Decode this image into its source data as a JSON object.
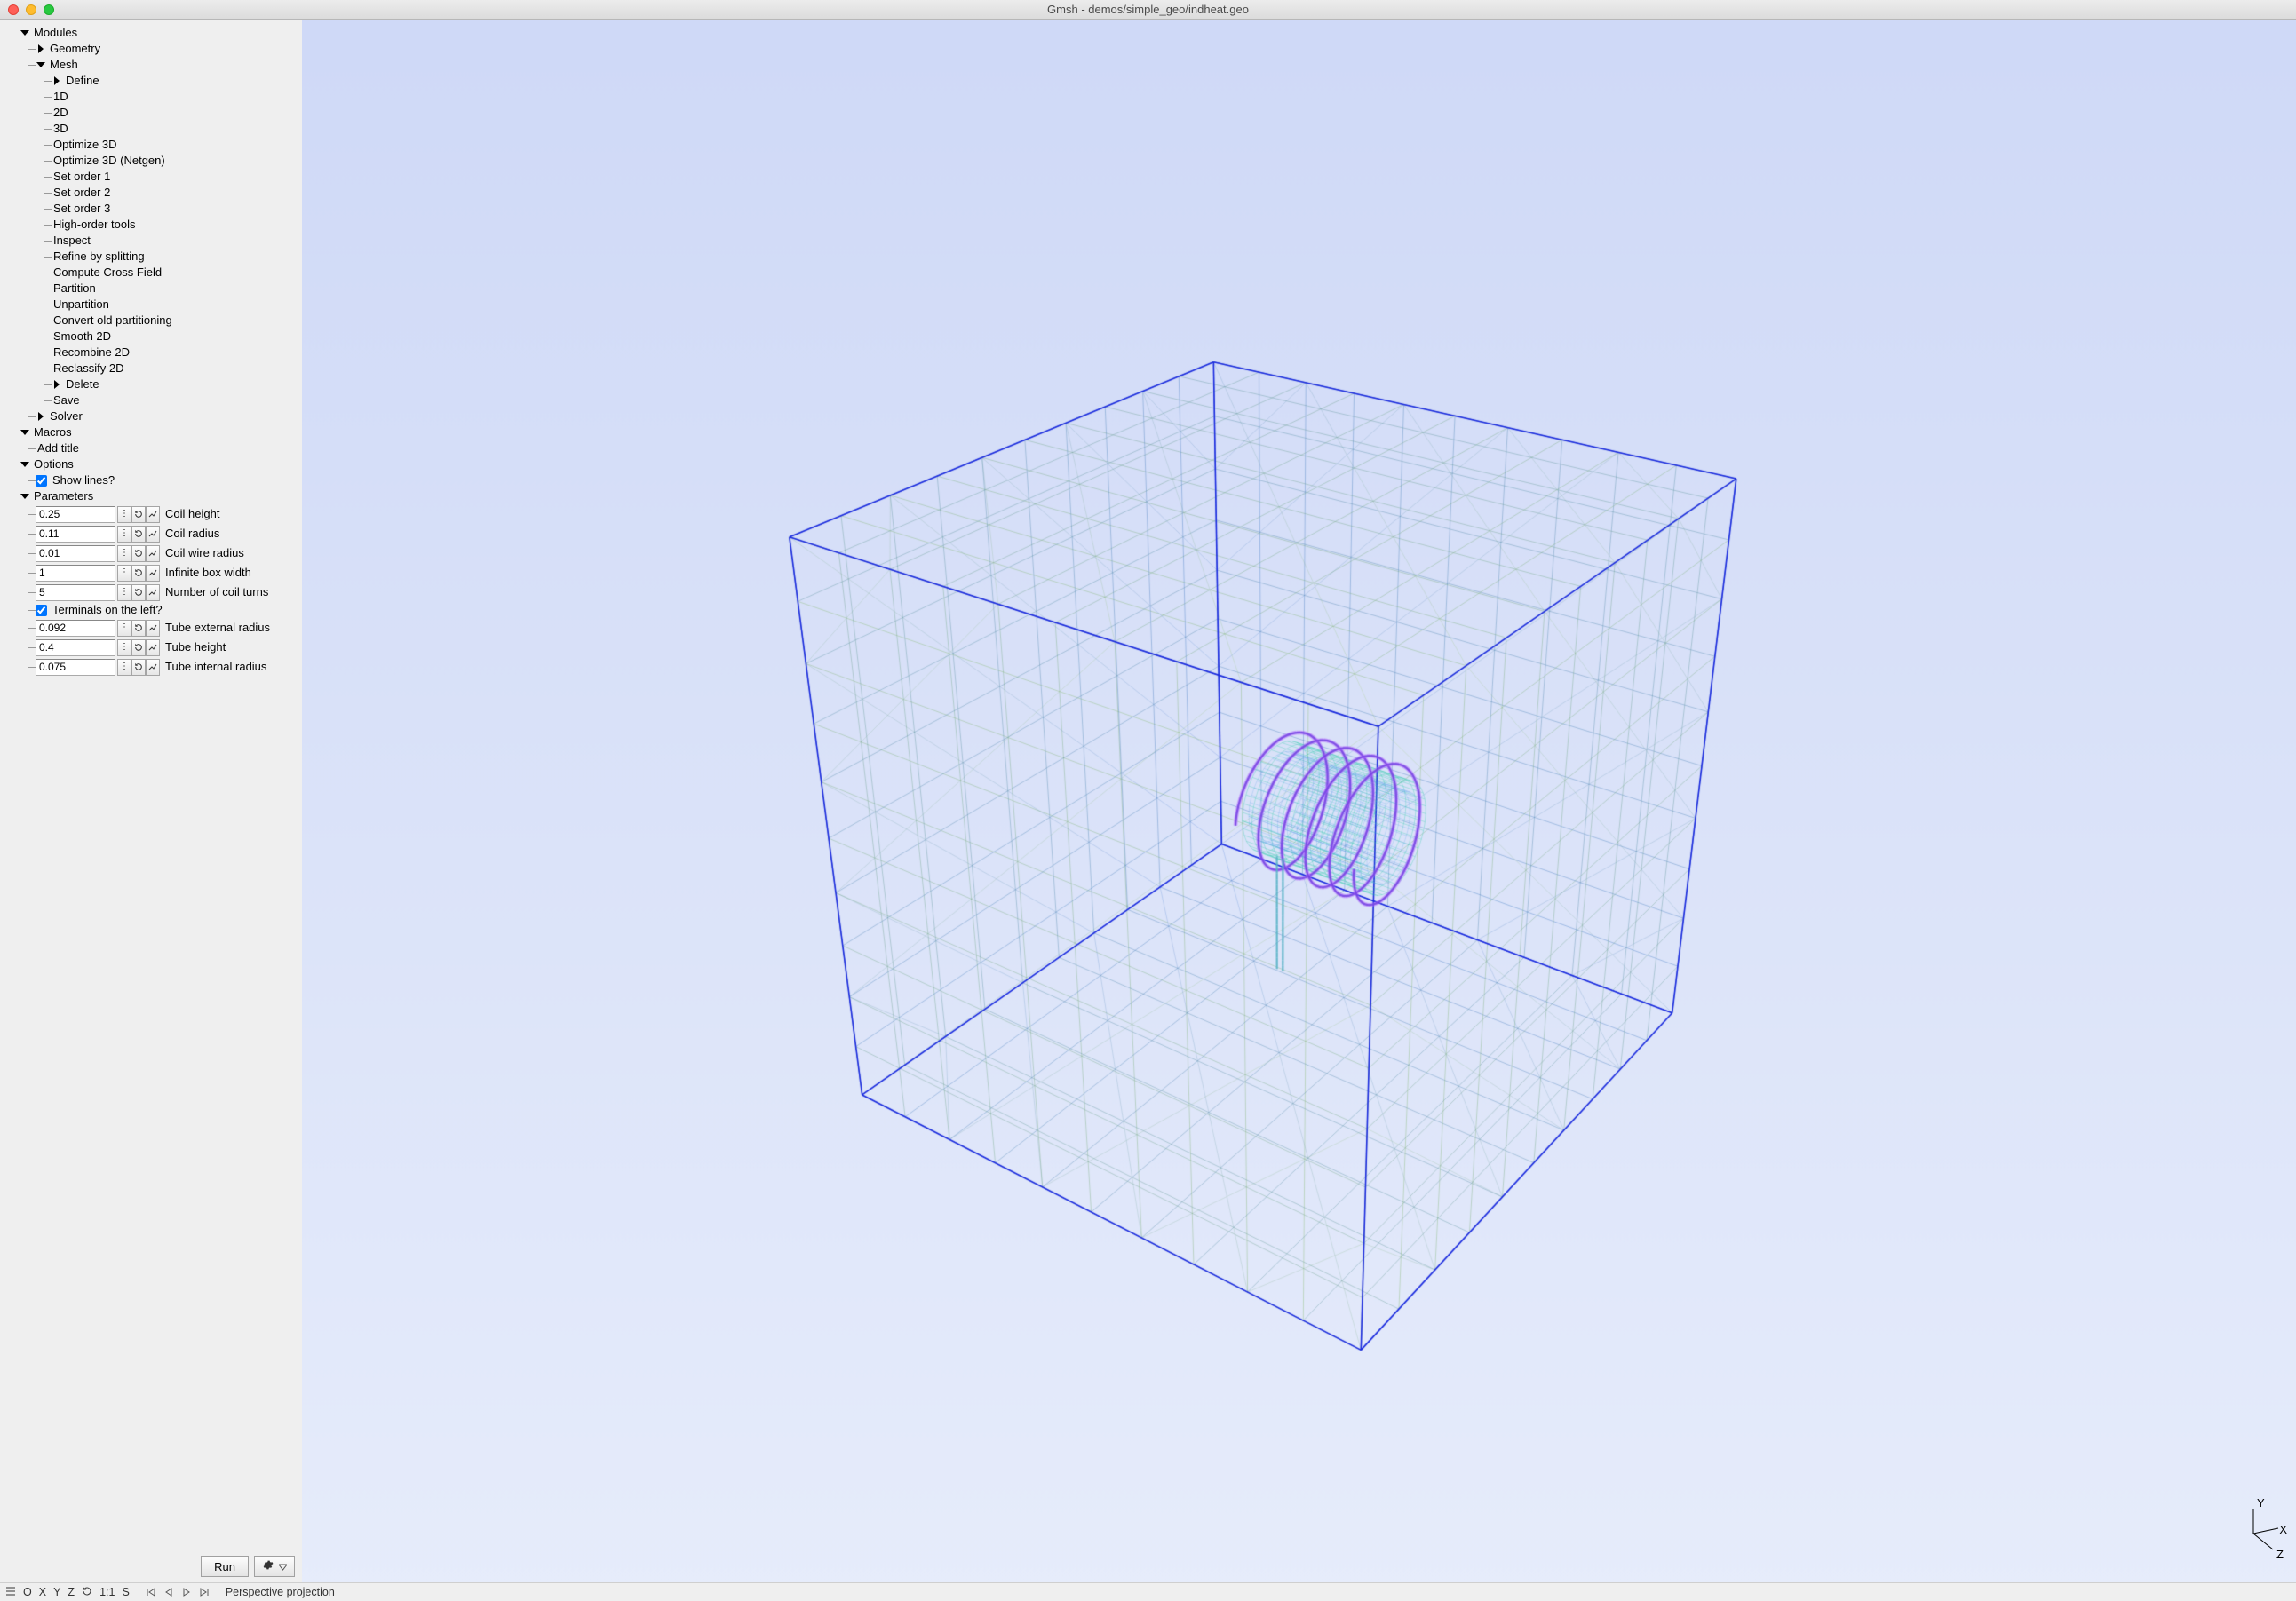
{
  "window": {
    "title": "Gmsh - demos/simple_geo/indheat.geo"
  },
  "tree": {
    "modules": "Modules",
    "geometry": "Geometry",
    "mesh": "Mesh",
    "mesh_items": {
      "define": "Define",
      "oneD": "1D",
      "twoD": "2D",
      "threeD": "3D",
      "opt3d": "Optimize 3D",
      "opt3dnet": "Optimize 3D (Netgen)",
      "so1": "Set order 1",
      "so2": "Set order 2",
      "so3": "Set order 3",
      "hot": "High-order tools",
      "inspect": "Inspect",
      "refine": "Refine by splitting",
      "ccf": "Compute Cross Field",
      "partition": "Partition",
      "unpartition": "Unpartition",
      "convert": "Convert old partitioning",
      "smooth": "Smooth 2D",
      "recombine": "Recombine 2D",
      "reclass": "Reclassify 2D",
      "delete": "Delete",
      "save": "Save"
    },
    "solver": "Solver",
    "macros": "Macros",
    "add_title": "Add title",
    "options": "Options",
    "show_lines": "Show lines?",
    "parameters": "Parameters",
    "params": [
      {
        "value": "0.25",
        "label": "Coil height"
      },
      {
        "value": "0.11",
        "label": "Coil radius"
      },
      {
        "value": "0.01",
        "label": "Coil wire radius"
      },
      {
        "value": "1",
        "label": "Infinite box width"
      },
      {
        "value": "5",
        "label": "Number of coil turns"
      }
    ],
    "terminals_left": "Terminals on the left?",
    "params2": [
      {
        "value": "0.092",
        "label": "Tube external radius"
      },
      {
        "value": "0.4",
        "label": "Tube height"
      },
      {
        "value": "0.075",
        "label": "Tube internal radius"
      }
    ]
  },
  "buttons": {
    "run": "Run"
  },
  "status": {
    "menu": "≡",
    "O": "O",
    "X": "X",
    "Y": "Y",
    "Z": "Z",
    "rot": "↻",
    "ratio": "1:1",
    "S": "S",
    "proj": "Perspective projection"
  },
  "axes": {
    "X": "X",
    "Y": "Y",
    "Z": "Z"
  }
}
